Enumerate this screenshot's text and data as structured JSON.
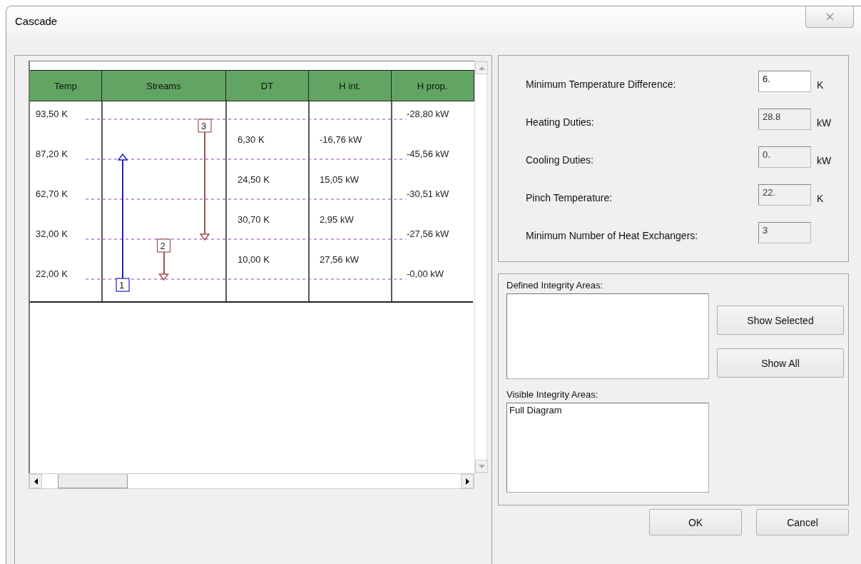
{
  "window": {
    "title": "Cascade"
  },
  "table": {
    "columns": [
      "Temp",
      "Streams",
      "DT",
      "H int.",
      "H prop."
    ],
    "levels": [
      {
        "temp": "93,50 K",
        "h_prop": "-28,80 kW"
      },
      {
        "temp": "87,20 K",
        "h_prop": "-45,56 kW"
      },
      {
        "temp": "62,70 K",
        "h_prop": "-30,51 kW"
      },
      {
        "temp": "32,00 K",
        "h_prop": "-27,56 kW"
      },
      {
        "temp": "22,00 K",
        "h_prop": "-0,00 kW"
      }
    ],
    "intervals": [
      {
        "dt": "6,30 K",
        "h_int": "-16,76 kW"
      },
      {
        "dt": "24,50 K",
        "h_int": "15,05 kW"
      },
      {
        "dt": "30,70 K",
        "h_int": "2,95 kW"
      },
      {
        "dt": "10,00 K",
        "h_int": "27,56 kW"
      }
    ],
    "streams": [
      {
        "label": "1",
        "kind": "cold",
        "color": "#2020c0",
        "spans": [
          false,
          true,
          true,
          true
        ]
      },
      {
        "label": "2",
        "kind": "hot",
        "color": "#a05050",
        "spans": [
          false,
          false,
          false,
          true
        ]
      },
      {
        "label": "3",
        "kind": "hot",
        "color": "#a05050",
        "spans": [
          true,
          true,
          true,
          false
        ]
      }
    ]
  },
  "results": [
    {
      "label": "Minimum Temperature Difference:",
      "value": "6.",
      "unit": "K",
      "disabled": false
    },
    {
      "label": "Heating Duties:",
      "value": "28.8",
      "unit": "kW",
      "disabled": true
    },
    {
      "label": "Cooling Duties:",
      "value": "0.",
      "unit": "kW",
      "disabled": true
    },
    {
      "label": "Pinch Temperature:",
      "value": "22.",
      "unit": "K",
      "disabled": true
    },
    {
      "label": "Minimum Number of Heat Exchangers:",
      "value": "3",
      "disabled": true
    }
  ],
  "integrity": {
    "defined_label": "Defined Integrity Areas:",
    "buttons": [
      "Show Selected",
      "Show All"
    ],
    "visible_label": "Visible Integrity Areas:",
    "visible_items": [
      "Full Diagram"
    ]
  },
  "buttons": [
    "OK",
    "Cancel"
  ]
}
